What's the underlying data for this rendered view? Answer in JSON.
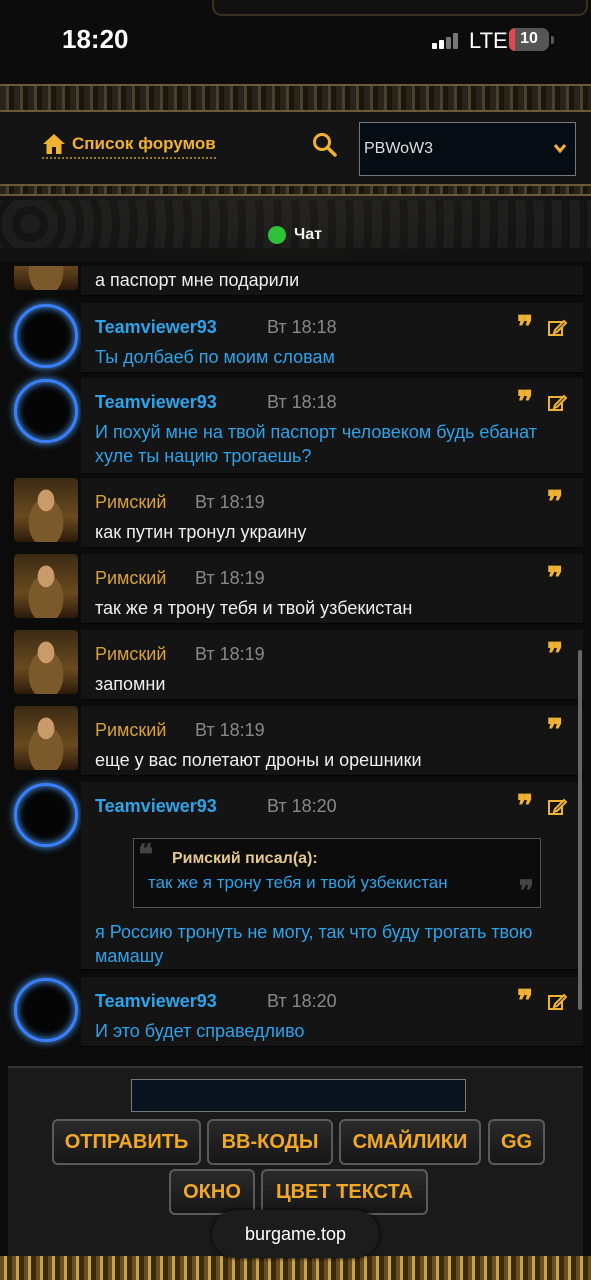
{
  "status_bar": {
    "time": "18:20",
    "network": "LTE",
    "battery": "10",
    "battery_level": 0.1
  },
  "header": {
    "forums_link": "Список форумов",
    "forum_select": "PBWoW3",
    "chat_title": "Чат"
  },
  "messages": [
    {
      "author": "",
      "time": "",
      "text": "а паспорт мне подарили",
      "author_color": "gold"
    },
    {
      "author": "Teamviewer93",
      "time": "Вт 18:18",
      "text": "Ты долбаеб по моим словам"
    },
    {
      "author": "Teamviewer93",
      "time": "Вт 18:18",
      "text": "И похуй мне на твой паспорт человеком будь ебанат хуле ты нацию трогаешь?"
    },
    {
      "author": "Римский",
      "time": "Вт 18:19",
      "text": "как путин тронул украину"
    },
    {
      "author": "Римский",
      "time": "Вт 18:19",
      "text": "так же я трону тебя и твой узбекистан"
    },
    {
      "author": "Римский",
      "time": "Вт 18:19",
      "text": "запомни"
    },
    {
      "author": "Римский",
      "time": "Вт 18:19",
      "text": "еще у вас полетают дроны и орешники"
    },
    {
      "author": "Teamviewer93",
      "time": "Вт 18:20",
      "quote": {
        "author": "Римский писал(а):",
        "text": "так же я трону тебя и твой узбекистан"
      },
      "text": "я Россию тронуть не могу, так что буду трогать твою мамашу"
    },
    {
      "author": "Teamviewer93",
      "time": "Вт 18:20",
      "text": "И это будет справедливо"
    }
  ],
  "toolbar": {
    "send": "ОТПРАВИТЬ",
    "bbcodes": "BB-КОДЫ",
    "smilies": "СМАЙЛИКИ",
    "gg": "GG",
    "window": "ОКНО",
    "text_color": "ЦВЕТ ТЕКСТА"
  },
  "browser": {
    "url": "burgame.top"
  },
  "colors": {
    "accent": "#f0b232",
    "link_blue": "#2da3ea",
    "online_green": "#2ec13a"
  }
}
